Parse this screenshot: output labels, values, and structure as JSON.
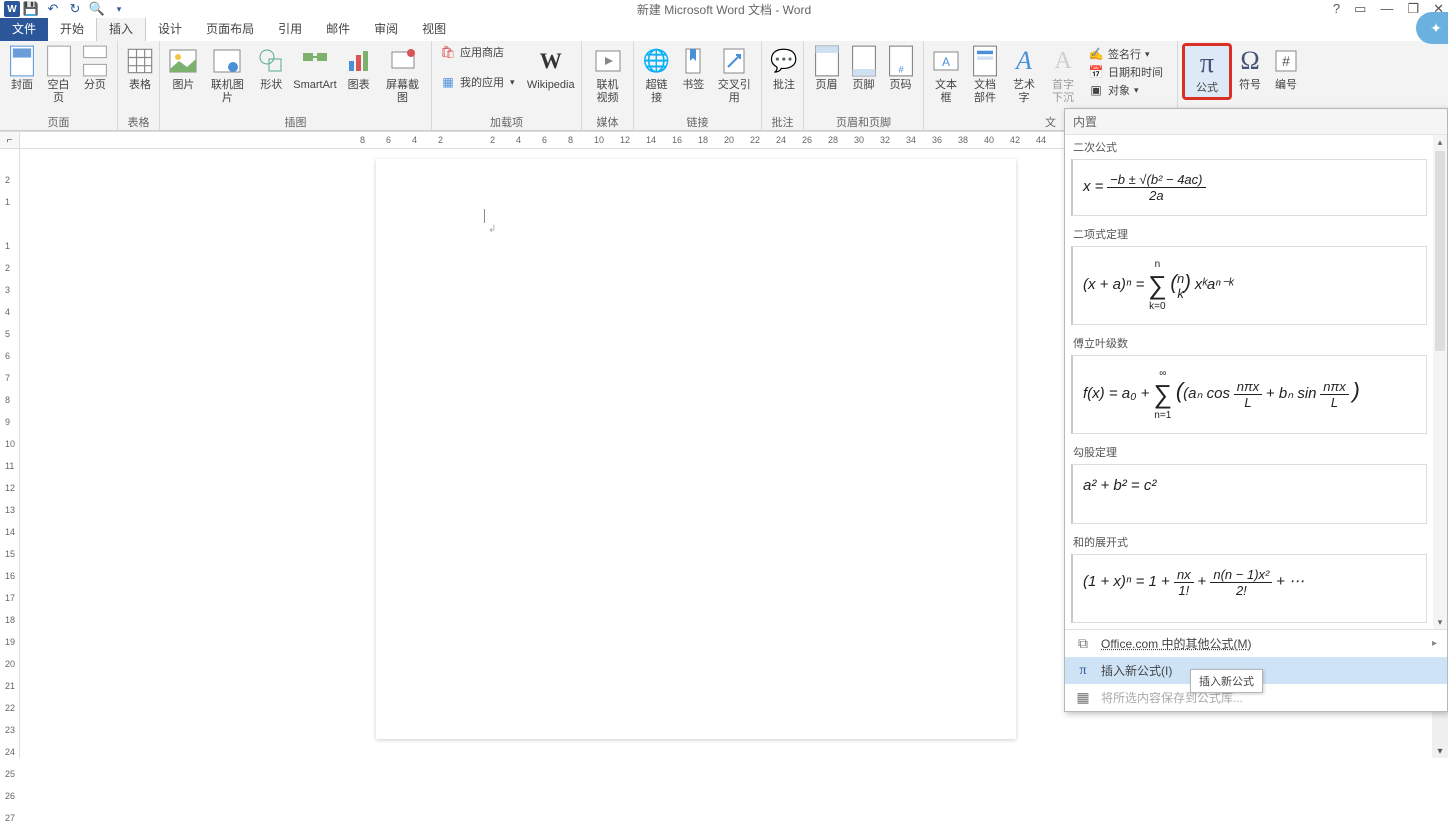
{
  "app": {
    "title": "新建 Microsoft Word 文档 - Word",
    "word_glyph": "W"
  },
  "wincontrols": {
    "help": "?",
    "ribbonmin": "▭",
    "min": "—",
    "restore": "❐",
    "close": "✕"
  },
  "tabs": {
    "file": "文件",
    "home": "开始",
    "insert": "插入",
    "design": "设计",
    "layout": "页面布局",
    "references": "引用",
    "mailings": "邮件",
    "review": "审阅",
    "view": "视图"
  },
  "ribbon": {
    "pages": {
      "label": "页面",
      "cover": "封面",
      "blank": "空白页",
      "break": "分页"
    },
    "tables": {
      "label": "表格",
      "table": "表格"
    },
    "illustrations": {
      "label": "插图",
      "pictures": "图片",
      "online_pictures": "联机图片",
      "shapes": "形状",
      "smartart": "SmartArt",
      "chart": "图表",
      "screenshot": "屏幕截图"
    },
    "addins": {
      "label": "加载项",
      "store": "应用商店",
      "myapps": "我的应用",
      "wikipedia": "Wikipedia"
    },
    "media": {
      "label": "媒体",
      "onlinevideo": "联机视频"
    },
    "links": {
      "label": "链接",
      "hyperlink": "超链接",
      "bookmark": "书签",
      "crossref": "交叉引用"
    },
    "comments": {
      "label": "批注",
      "comment": "批注"
    },
    "headerfooter": {
      "label": "页眉和页脚",
      "header": "页眉",
      "footer": "页脚",
      "pagenum": "页码"
    },
    "text": {
      "label": "文",
      "textbox": "文本框",
      "quickparts": "文档部件",
      "wordart": "艺术字",
      "dropcap": "首字下沉",
      "sigline": "签名行",
      "datetime": "日期和时间",
      "object": "对象"
    },
    "symbols": {
      "label": "",
      "equation": "公式",
      "symbol": "符号",
      "number": "编号",
      "pi": "π",
      "omega": "Ω",
      "hash": "#"
    }
  },
  "ruler_h": [
    "8",
    "6",
    "4",
    "2",
    "",
    "2",
    "4",
    "6",
    "8",
    "10",
    "12",
    "14",
    "16",
    "18",
    "20",
    "22",
    "24",
    "26",
    "28",
    "30",
    "32",
    "34",
    "36",
    "38",
    "40",
    "42",
    "44"
  ],
  "ruler_v": [
    "",
    "2",
    "1",
    "",
    "1",
    "2",
    "3",
    "4",
    "5",
    "6",
    "7",
    "8",
    "9",
    "10",
    "11",
    "12",
    "13",
    "14",
    "15",
    "16",
    "17",
    "18",
    "19",
    "20",
    "21",
    "22",
    "23",
    "24",
    "25",
    "26",
    "27"
  ],
  "equation_panel": {
    "header": "内置",
    "sections": {
      "quadratic": {
        "title": "二次公式",
        "lhs": "x =",
        "num": "−b ± √(b² − 4ac)",
        "den": "2a"
      },
      "binomial": {
        "title": "二项式定理",
        "pre": "(x + a)ⁿ =",
        "sup": "n",
        "sub": "k=0",
        "binom_top": "n",
        "binom_bot": "k",
        "tail": " xᵏaⁿ⁻ᵏ"
      },
      "fourier": {
        "title": "傅立叶级数",
        "pre": "f(x) = a₀ + ",
        "sup": "∞",
        "sub": "n=1",
        "body": "(aₙ cos",
        "f1n": "nπx",
        "f1d": "L",
        "mid": " + bₙ sin",
        "f2n": "nπx",
        "f2d": "L",
        "close": ")"
      },
      "pythag": {
        "title": "勾股定理",
        "expr": "a² + b² = c²"
      },
      "expansion": {
        "title": "和的展开式",
        "pre": "(1 + x)ⁿ = 1 + ",
        "f1n": "nx",
        "f1d": "1!",
        "plus": " + ",
        "f2n": "n(n − 1)x²",
        "f2d": "2!",
        "tail": " + ⋯"
      }
    },
    "footer": {
      "more": "Office.com 中的其他公式(M)",
      "insert": "插入新公式(I)",
      "save": "将所选内容保存到公式库..."
    }
  },
  "tooltip": "插入新公式"
}
